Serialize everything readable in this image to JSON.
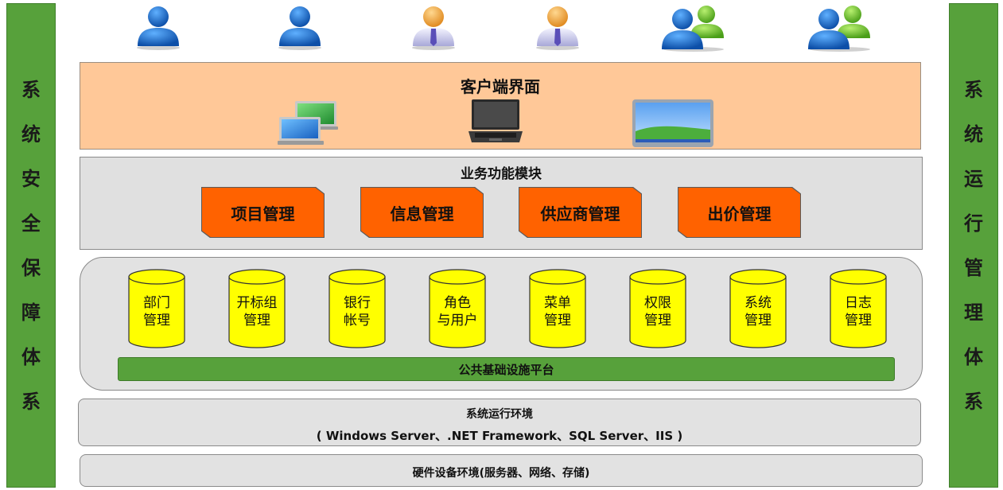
{
  "left_bar": {
    "chars": [
      "系",
      "统",
      "安",
      "全",
      "保",
      "障",
      "体",
      "系"
    ]
  },
  "right_bar": {
    "chars": [
      "系",
      "统",
      "运",
      "行",
      "管",
      "理",
      "体",
      "系"
    ]
  },
  "users": [
    {
      "type": "user-icon",
      "color": "#1f6fc9"
    },
    {
      "type": "user-icon",
      "color": "#1f6fc9"
    },
    {
      "type": "manager-icon",
      "color": "#f0a040"
    },
    {
      "type": "manager-icon",
      "color": "#f0a040"
    },
    {
      "type": "user-group-icon",
      "color": "#1f6fc9"
    },
    {
      "type": "user-group-icon",
      "color": "#1f6fc9"
    }
  ],
  "client": {
    "title": "客户端界面",
    "devices": [
      "tablets-icon",
      "laptop-icon",
      "monitor-icon"
    ]
  },
  "business": {
    "title": "业务功能模块",
    "modules": [
      "项目管理",
      "信息管理",
      "供应商管理",
      "出价管理"
    ]
  },
  "infra": {
    "cylinders": [
      {
        "line1": "部门",
        "line2": "管理"
      },
      {
        "line1": "开标组",
        "line2": "管理"
      },
      {
        "line1": "银行",
        "line2": "帐号"
      },
      {
        "line1": "角色",
        "line2": "与用户"
      },
      {
        "line1": "菜单",
        "line2": "管理"
      },
      {
        "line1": "权限",
        "line2": "管理"
      },
      {
        "line1": "系统",
        "line2": "管理"
      },
      {
        "line1": "日志",
        "line2": "管理"
      }
    ],
    "platform": "公共基础设施平台"
  },
  "env": {
    "title": "系统运行环境",
    "subtitle": "( Windows Server、.NET Framework、SQL Server、IIS )"
  },
  "hardware": {
    "title": "硬件设备环境(服务器、网络、存储)"
  },
  "colors": {
    "green": "#57a13b",
    "orange_panel": "#ffc898",
    "module_orange": "#ff6200",
    "cylinder_yellow": "#ffff00"
  }
}
